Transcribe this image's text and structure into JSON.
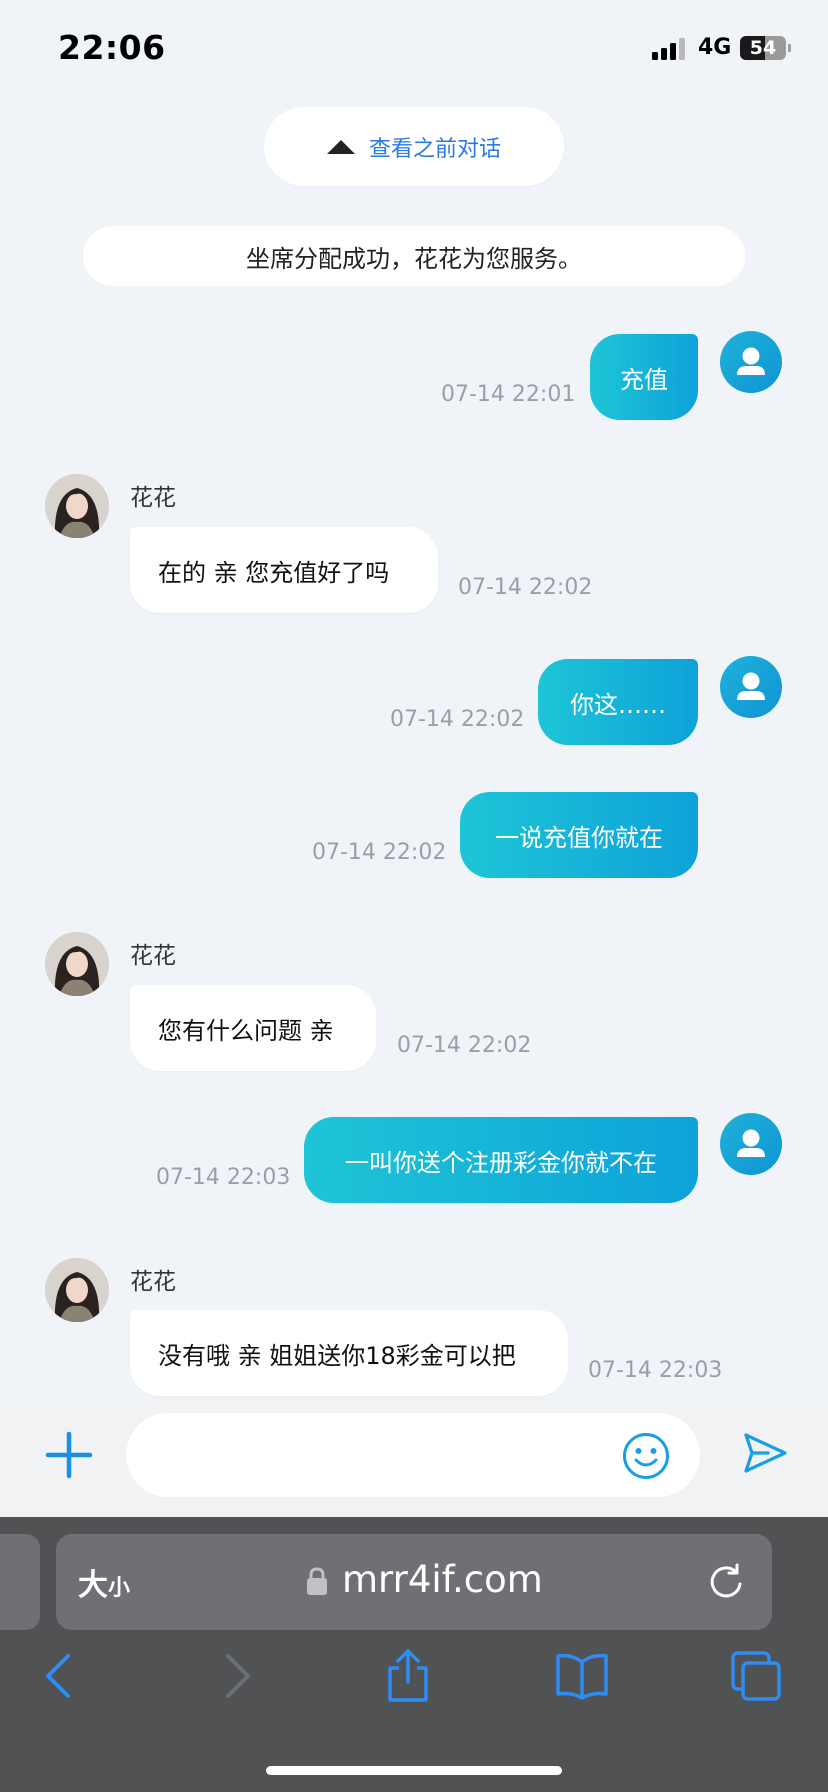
{
  "status_bar": {
    "time": "22:06",
    "network": "4G",
    "battery": "54",
    "battery_fraction": 0.54
  },
  "chat": {
    "history_link": "查看之前对话",
    "system_notice": "坐席分配成功，花花为您服务。",
    "agent_name": "花花",
    "messages": [
      {
        "from": "user",
        "text": "充值",
        "time": "07-14 22:01"
      },
      {
        "from": "agent",
        "name": "花花",
        "text": "在的 亲 您充值好了吗",
        "time": "07-14 22:02"
      },
      {
        "from": "user",
        "text": "你这……",
        "time": "07-14 22:02"
      },
      {
        "from": "user",
        "text": "一说充值你就在",
        "time": "07-14 22:02"
      },
      {
        "from": "agent",
        "name": "花花",
        "text": "您有什么问题 亲",
        "time": "07-14 22:02"
      },
      {
        "from": "user",
        "text": "一叫你送个注册彩金你就不在",
        "time": "07-14 22:03"
      },
      {
        "from": "agent",
        "name": "花花",
        "text": "没有哦 亲 姐姐送你18彩金可以把",
        "time": "07-14 22:03"
      }
    ]
  },
  "input_bar": {
    "placeholder": ""
  },
  "safari": {
    "text_size_big": "大",
    "text_size_small": "小",
    "url": "mrr4if.com"
  },
  "colors": {
    "accent": "#0ea2d9",
    "user_bubble_start": "#1ec5d6",
    "link_blue": "#2a7ae2",
    "toolbar_blue": "#2f8cf2"
  },
  "icons": [
    "signal-icon",
    "battery-icon",
    "caret-up-icon",
    "user-avatar-icon",
    "plus-icon",
    "emoji-icon",
    "send-icon",
    "lock-icon",
    "reload-icon",
    "back-icon",
    "forward-icon",
    "share-icon",
    "bookmarks-icon",
    "tabs-icon"
  ]
}
